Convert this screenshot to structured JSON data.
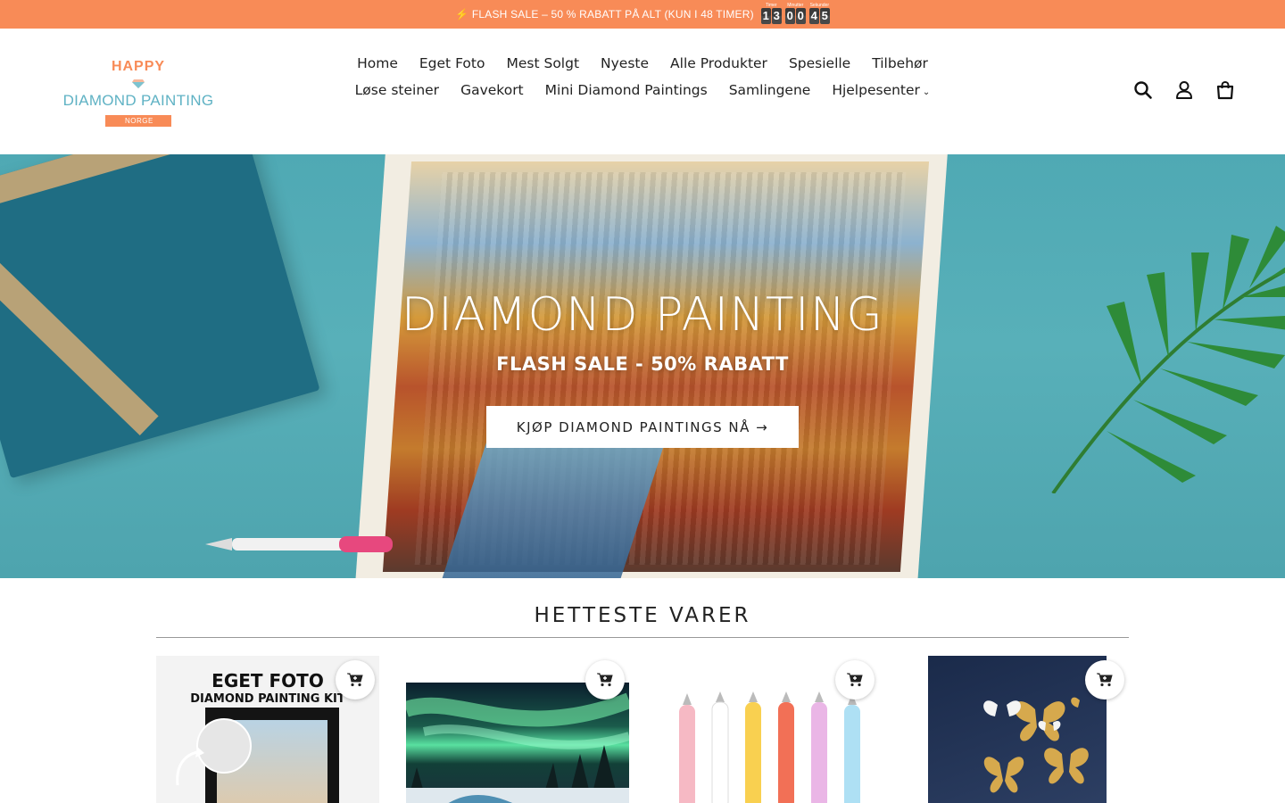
{
  "announcement": {
    "text": "⚡ FLASH SALE – 50 % RABATT PÅ ALT (KUN I 48 TIMER)",
    "countdown": [
      {
        "label": "Timer",
        "digits": [
          "1",
          "3"
        ]
      },
      {
        "label": "Minutter",
        "digits": [
          "0",
          "0"
        ]
      },
      {
        "label": "Sekunder",
        "digits": [
          "4",
          "5"
        ]
      }
    ]
  },
  "logo": {
    "line1": "HAPPY",
    "line2": "DIAMOND PAINTING",
    "line3": "NORGE",
    "colors": {
      "orange": "#f88b57",
      "teal": "#5fb2c4"
    }
  },
  "nav": {
    "items": [
      "Home",
      "Eget Foto",
      "Mest Solgt",
      "Nyeste",
      "Alle Produkter",
      "Spesielle",
      "Tilbehør",
      "Løse steiner",
      "Gavekort",
      "Mini Diamond Paintings",
      "Samlingene"
    ],
    "help": "Hjelpesenter"
  },
  "header_icons": [
    "search-icon",
    "account-icon",
    "cart-icon"
  ],
  "hero": {
    "title": "DIAMOND PAINTING",
    "subtitle": "FLASH SALE - 50% RABATT",
    "cta": "KJØP DIAMOND PAINTINGS NÅ →"
  },
  "section": {
    "title": "HETTESTE VARER"
  },
  "products": [
    {
      "title_line1": "EGET FOTO",
      "title_line2": "DIAMOND PAINTING KIT",
      "kind": "custom-photo"
    },
    {
      "kind": "northern-lights"
    },
    {
      "kind": "diamond-pens"
    },
    {
      "kind": "golden-butterflies"
    }
  ],
  "colors": {
    "accent": "#f88b57",
    "text": "#222222"
  }
}
